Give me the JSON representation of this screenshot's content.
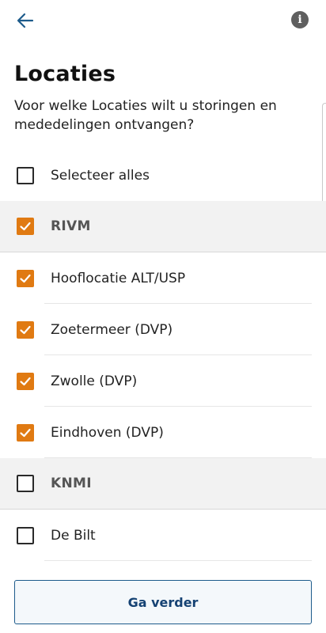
{
  "header": {
    "back_icon": "arrow-left-icon",
    "info_icon": "info-circle-icon",
    "info_glyph": "i"
  },
  "page": {
    "title": "Locaties",
    "subtitle": "Voor welke Locaties wilt u storingen en mededelingen ontvangen?"
  },
  "colors": {
    "accent": "#e07a12",
    "link": "#154273",
    "group_bg": "#f2f2f2"
  },
  "list": {
    "select_all": {
      "label": "Selecteer alles",
      "checked": false
    },
    "rows": [
      {
        "type": "group",
        "label": "RIVM",
        "checked": true
      },
      {
        "type": "item",
        "label": "Hooflocatie ALT/USP",
        "checked": true
      },
      {
        "type": "item",
        "label": "Zoetermeer (DVP)",
        "checked": true
      },
      {
        "type": "item",
        "label": "Zwolle (DVP)",
        "checked": true
      },
      {
        "type": "item",
        "label": "Eindhoven (DVP)",
        "checked": true
      },
      {
        "type": "group",
        "label": "KNMI",
        "checked": false
      },
      {
        "type": "item",
        "label": "De Bilt",
        "checked": false
      }
    ]
  },
  "footer": {
    "continue_label": "Ga verder"
  }
}
